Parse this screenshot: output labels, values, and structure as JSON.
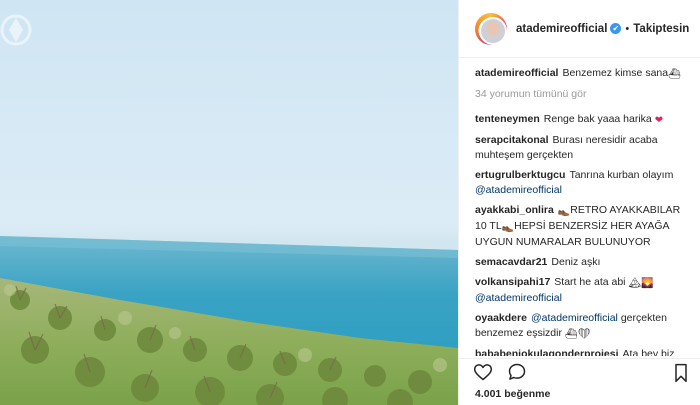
{
  "header": {
    "username": "atademireofficial",
    "verified_badge": "✔",
    "separator": "•",
    "follow_status": "Takiptesin"
  },
  "caption": {
    "username": "atademireofficial",
    "text": "Benzemez kimse sana",
    "emoji": "⛴"
  },
  "load_more": "34 yorumun tümünü gör",
  "comments": [
    {
      "user": "tenteneymen",
      "text": "Renge bak yaaa harika",
      "emoji": "❤"
    },
    {
      "user": "serapcitakonal",
      "text": "Burası neresidir acaba muhteşem gerçekten"
    },
    {
      "user": "ertugrulberktugcu",
      "text": "Tanrına kurban olayım",
      "mention": "@atademireofficial"
    },
    {
      "user": "ayakkabi_onlira",
      "emoji": "👞",
      "text": "RETRO AYAKKABILAR 10 TL",
      "emoji2": "👞",
      "text2": "HEPSİ BENZERSİZ HER AYAĞA UYGUN NUMARALAR BULUNUYOR"
    },
    {
      "user": "semacavdar21",
      "text": "Deniz aşkı"
    },
    {
      "user": "volkansipahi17",
      "text": "Start he ata abi",
      "emoji": "🏔🌄",
      "mention": "@atademireofficial"
    },
    {
      "user": "oyaakdere",
      "mention": "@atademireofficial",
      "text": "gerçekten benzemez eşsizdir",
      "emoji": "⛴❤"
    },
    {
      "user": "bababeniokulagonderprojesi",
      "text": "Ata bey biz \"Baba Beni Okula Gönder Projesi\""
    }
  ],
  "likes": "4.001 beğenme",
  "icons": {
    "like": "heart-icon",
    "comment": "comment-icon",
    "save": "bookmark-icon"
  },
  "colors": {
    "mention": "#003569",
    "verified": "#3897f0",
    "muted": "#999999"
  }
}
